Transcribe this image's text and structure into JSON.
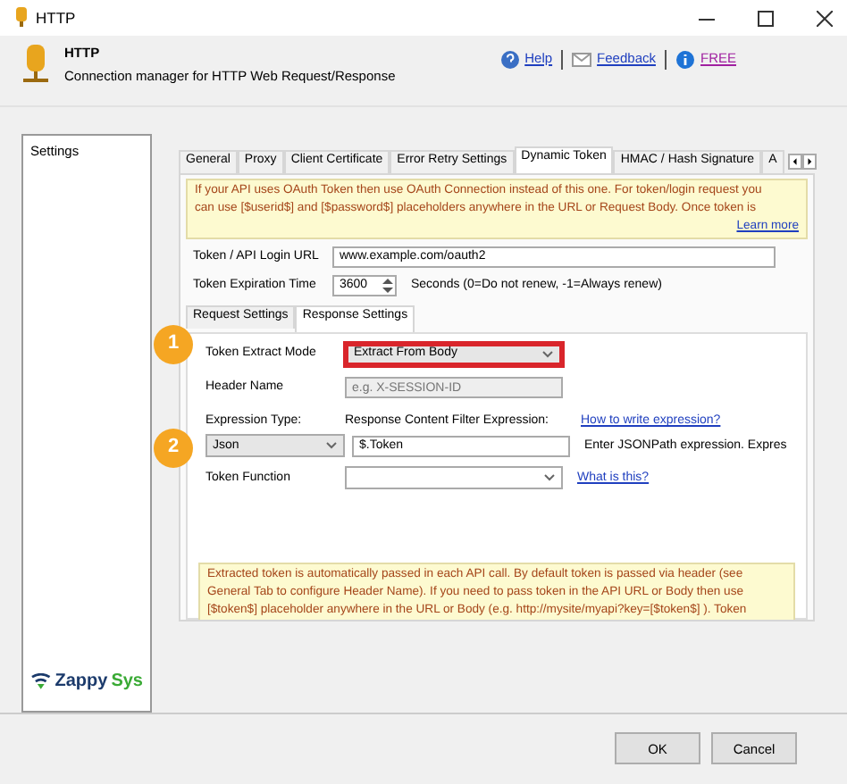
{
  "window": {
    "title": "HTTP"
  },
  "header": {
    "title": "HTTP",
    "subtitle": "Connection manager for HTTP Web Request/Response",
    "links": [
      {
        "label": "Help",
        "kind": "help"
      },
      {
        "label": "Feedback",
        "kind": "feedback"
      },
      {
        "label": "FREE",
        "kind": "free"
      }
    ]
  },
  "sidebar": {
    "items": [
      {
        "label": "Settings"
      }
    ],
    "logo": [
      "Zappy",
      "Sys"
    ]
  },
  "tabs": [
    {
      "label": "General",
      "selected": false
    },
    {
      "label": "Proxy",
      "selected": false
    },
    {
      "label": "Client Certificate",
      "selected": false
    },
    {
      "label": "Error Retry Settings",
      "selected": false
    },
    {
      "label": "Dynamic Token",
      "selected": true
    },
    {
      "label": "HMAC / Hash Signature",
      "selected": false
    },
    {
      "label": "A",
      "selected": false
    }
  ],
  "top_info": {
    "lines": [
      "If your API uses OAuth Token then use OAuth Connection instead of this one. For token/login request you",
      "can use [$userid$] and [$password$] placeholders anywhere in the URL or Request Body. Once token is"
    ],
    "link": "Learn more"
  },
  "login_url": {
    "label": "Token / API Login URL",
    "value": "www.example.com/oauth2"
  },
  "expiration": {
    "label": "Token Expiration Time",
    "value": "3600",
    "hint": "Seconds (0=Do not renew, -1=Always renew)"
  },
  "sub_tabs": [
    {
      "label": "Request Settings",
      "selected": false
    },
    {
      "label": "Response Settings",
      "selected": true
    }
  ],
  "extract_mode": {
    "label": "Token Extract Mode",
    "value": "Extract From Body",
    "highlighted": true
  },
  "header_name": {
    "label": "Header Name",
    "placeholder": "e.g. X-SESSION-ID",
    "disabled": true
  },
  "expression": {
    "type_label": "Expression Type:",
    "filter_label": "Response Content Filter Expression:",
    "link": "How to write expression?",
    "type_value": "Json",
    "filter_value": "$.Token",
    "hint": "Enter JSONPath expression. Expres"
  },
  "token_function": {
    "label": "Token Function",
    "link": "What is this?"
  },
  "bottom_info": {
    "lines": [
      "Extracted token is automatically passed in each API call. By default token is passed via header (see",
      "General Tab to configure Header Name). If you need to pass token in the API URL or Body then use",
      "[$token$] placeholder anywhere in the URL or Body (e.g. http://mysite/myapi?key=[$token$] ). Token"
    ]
  },
  "callouts": [
    "1",
    "2"
  ],
  "buttons": [
    "OK",
    "Cancel"
  ]
}
